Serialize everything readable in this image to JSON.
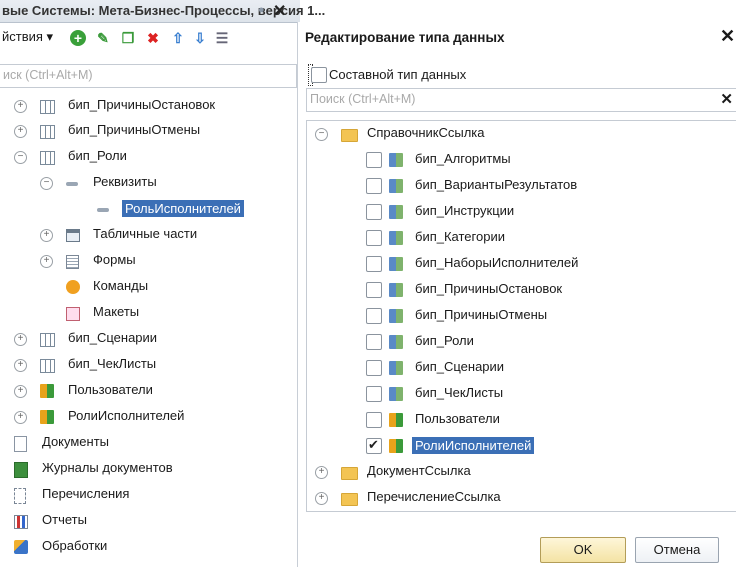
{
  "left_window": {
    "title": "вые Системы: Мета-Бизнес-Процессы, версия 1...",
    "actions_label": "йствия ▾",
    "search_placeholder": "иск (Ctrl+Alt+M)",
    "tree": [
      {
        "label": "бип_ПричиныОстановок",
        "icon": "table-icon"
      },
      {
        "label": "бип_ПричиныОтмены",
        "icon": "table-icon"
      },
      {
        "label": "бип_Роли",
        "icon": "table-icon"
      },
      {
        "label": "Реквизиты",
        "icon": "attribute-icon"
      },
      {
        "label": "РольИсполнителей",
        "icon": "attribute-icon"
      },
      {
        "label": "Табличные части",
        "icon": "tabular-section-icon"
      },
      {
        "label": "Формы",
        "icon": "form-icon"
      },
      {
        "label": "Команды",
        "icon": "command-icon"
      },
      {
        "label": "Макеты",
        "icon": "layout-icon"
      },
      {
        "label": "бип_Сценарии",
        "icon": "table-icon"
      },
      {
        "label": "бип_ЧекЛисты",
        "icon": "table-icon"
      },
      {
        "label": "Пользователи",
        "icon": "catalog-user-icon"
      },
      {
        "label": "РолиИсполнителей",
        "icon": "catalog-user-icon"
      },
      {
        "label": "Документы",
        "icon": "document-icon"
      },
      {
        "label": "Журналы документов",
        "icon": "journal-icon"
      },
      {
        "label": "Перечисления",
        "icon": "enum-icon"
      },
      {
        "label": "Отчеты",
        "icon": "report-icon"
      },
      {
        "label": "Обработки",
        "icon": "processing-icon"
      }
    ]
  },
  "dialog": {
    "title": "Редактирование типа данных",
    "composite_label": "Составной тип данных",
    "search_placeholder": "Поиск (Ctrl+Alt+M)",
    "tree": {
      "root_catalog": "СправочникСсылка",
      "catalog_items": [
        {
          "label": "бип_Алгоритмы",
          "checked": false
        },
        {
          "label": "бип_ВариантыРезультатов",
          "checked": false
        },
        {
          "label": "бип_Инструкции",
          "checked": false
        },
        {
          "label": "бип_Категории",
          "checked": false
        },
        {
          "label": "бип_НаборыИсполнителей",
          "checked": false
        },
        {
          "label": "бип_ПричиныОстановок",
          "checked": false
        },
        {
          "label": "бип_ПричиныОтмены",
          "checked": false
        },
        {
          "label": "бип_Роли",
          "checked": false
        },
        {
          "label": "бип_Сценарии",
          "checked": false
        },
        {
          "label": "бип_ЧекЛисты",
          "checked": false
        },
        {
          "label": "Пользователи",
          "checked": false
        },
        {
          "label": "РолиИсполнителей",
          "checked": true
        }
      ],
      "root_document": "ДокументСсылка",
      "root_enum": "ПеречислениеСсылка"
    },
    "ok_label": "OK",
    "cancel_label": "Отмена"
  },
  "colors": {
    "selection": "#3b6fb6",
    "ok_button": "#f4e3a4"
  }
}
